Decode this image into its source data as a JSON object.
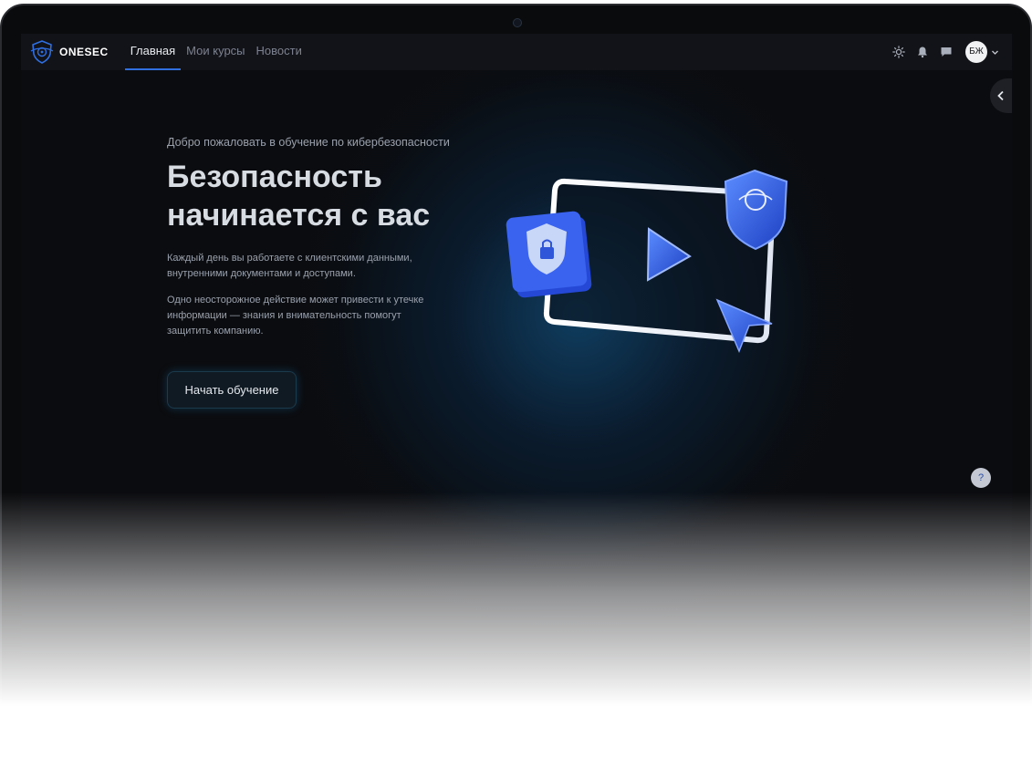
{
  "brand": {
    "name": "ONESEC"
  },
  "nav": {
    "items": [
      {
        "label": "Главная",
        "active": true
      },
      {
        "label": "Мои курсы",
        "active": false
      },
      {
        "label": "Новости",
        "active": false
      }
    ]
  },
  "user": {
    "initials": "БЖ"
  },
  "hero": {
    "welcome": "Добро пожаловать в обучение по кибербезопасности",
    "headline_line1": "Безопасность",
    "headline_line2": "начинается с вас",
    "paragraph1": "Каждый день вы работаете с клиентскими данными, внутренними документами и доступами.",
    "paragraph2": "Одно неосторожное действие может привести к утечке информации — знания и внимательность помогут защитить компанию.",
    "cta_label": "Начать обучение"
  },
  "help": {
    "label": "?"
  },
  "colors": {
    "accent": "#2f6fe0",
    "background": "#0b0c0f",
    "topbar": "#121318",
    "text_primary": "#d7dbe2",
    "text_secondary": "#9aa1ad"
  },
  "icons": [
    "brand-shield-icon",
    "sun-icon",
    "bell-icon",
    "chat-icon",
    "chevron-down-icon",
    "chevron-left-icon"
  ]
}
